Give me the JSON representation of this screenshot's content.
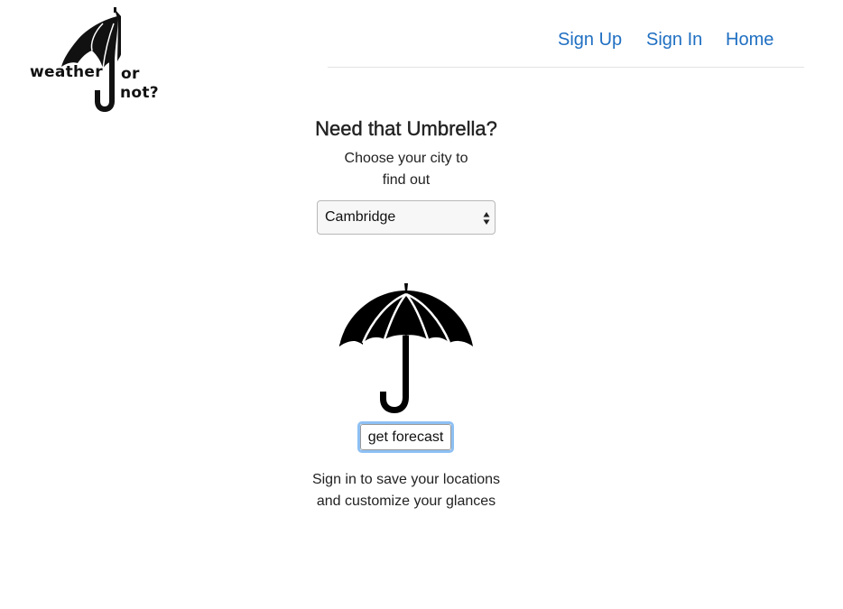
{
  "logo": {
    "word_1": "weather",
    "word_2": "or",
    "word_3": "not?",
    "icon": "umbrella-logo-icon"
  },
  "nav": {
    "items": [
      {
        "label": "Sign Up"
      },
      {
        "label": "Sign In"
      },
      {
        "label": "Home"
      }
    ],
    "link_color": "#1f6fc2"
  },
  "main": {
    "heading": "Need that Umbrella?",
    "prompt_line_1": "Choose your city to",
    "prompt_line_2": "find out",
    "city_select": {
      "selected": "Cambridge",
      "icon": "select-arrows-icon"
    },
    "hero_icon": "umbrella-icon",
    "forecast_button_label": "get forecast",
    "note_line_1": "Sign in to save your locations",
    "note_line_2": "and customize your glances"
  },
  "colors": {
    "focus_ring": "#8ec0f3",
    "text": "#222222"
  }
}
